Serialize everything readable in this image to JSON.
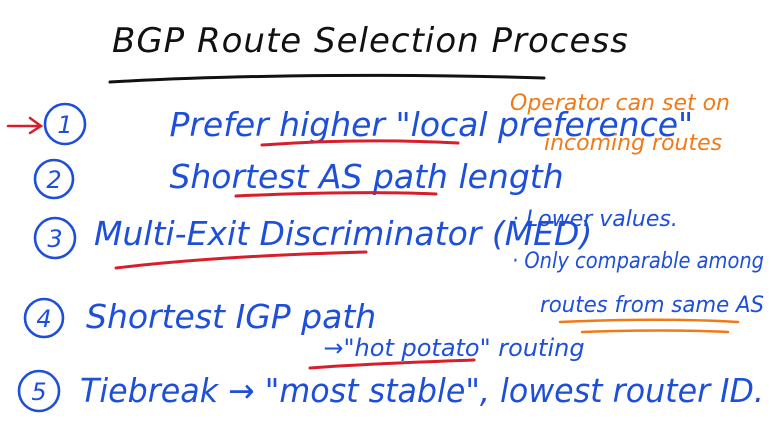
{
  "title": "BGP Route Selection Process",
  "steps": [
    {
      "number": "1",
      "before": "Prefer higher ",
      "highlight": "\"local preference\"",
      "after": ""
    },
    {
      "number": "2",
      "before": "Shortest ",
      "highlight": "AS path length",
      "after": ""
    },
    {
      "number": "3",
      "before": "Multi-Exit Discriminator (MED)",
      "highlight": "",
      "after": ""
    },
    {
      "number": "4",
      "before": "Shortest IGP path",
      "highlight": "",
      "after": ""
    },
    {
      "number": "5",
      "before": "Tiebreak → \"most stable\", lowest router ID.",
      "highlight": "",
      "after": ""
    }
  ],
  "hot_potato": {
    "arrow": "→",
    "highlight": "\"hot potato\"",
    "after": " routing"
  },
  "operator_note": [
    "Operator can set on",
    "incoming routes"
  ],
  "med_notes": {
    "line1": "· Lower values.",
    "line2": "· Only comparable among",
    "line3": "routes from same AS"
  },
  "colors": {
    "ink_blue": "#1d4fd8",
    "ink_black": "#111111",
    "ink_red": "#d81e2c",
    "ink_orange": "#f07a18"
  }
}
